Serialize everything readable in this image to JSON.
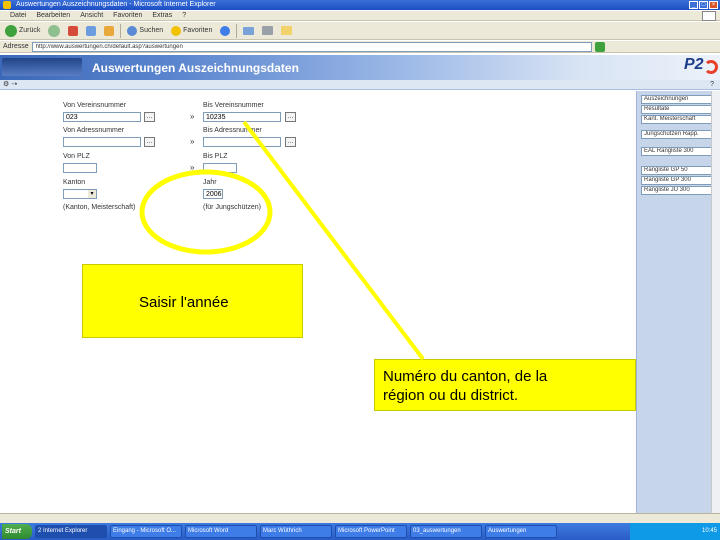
{
  "window": {
    "title": "Auswertungen Auszeichnungsdaten - Microsoft Internet Explorer"
  },
  "menu": [
    "Datei",
    "Bearbeiten",
    "Ansicht",
    "Favoriten",
    "Extras",
    "?"
  ],
  "toolbar": {
    "back": "Zurück",
    "search": "Suchen",
    "favorites": "Favoriten"
  },
  "address": {
    "label": "Adresse",
    "url": "http://www.auswertungen.ch/default.asp?auswertungen"
  },
  "banner": {
    "title": "Auswertungen Auszeichnungsdaten",
    "logo": "P2"
  },
  "subbar": {
    "help": "?"
  },
  "form": {
    "von_vereinsnummer_label": "Von Vereinsnummer",
    "von_vereinsnummer_value": "023",
    "bis_vereinsnummer_label": "Bis Vereinsnummer",
    "bis_vereinsnummer_value": "10235",
    "von_adressnummer_label": "Von Adressnummer",
    "bis_adressnummer_label": "Bis Adressnummer",
    "von_plz_label": "Von PLZ",
    "bis_plz_label": "Bis PLZ",
    "kanton_label": "Kanton",
    "jahr_label": "Jahr",
    "jahr_value": "2006",
    "arrow": "»",
    "lookup": "…",
    "footer_left": "(Kanton, Meisterschaft)",
    "footer_right": "(für Jungschützen)"
  },
  "right_panel": {
    "group1": [
      "Auszeichnungen",
      "Resultate",
      "Kant. Meisterschaft"
    ],
    "group2": [
      "Jungschützen Rapp."
    ],
    "group3": [
      "EAL Rangliste 300"
    ],
    "group4": [
      "Rangliste GP 50",
      "Rangliste GP 300",
      "Rangliste JU 300"
    ]
  },
  "taskbar": {
    "start": "Start",
    "tasks": [
      "2 Internet Explorer",
      "Eingang - Microsoft O...",
      "Microsoft Word",
      "Marc Wüthrich",
      "Microsoft PowerPoint",
      "03_auswertungen",
      "Auswertungen"
    ],
    "clock": "10:45"
  },
  "annotations": {
    "callout_year": "Saisir l'année",
    "callout_canton_line1": "Numéro du canton, de la",
    "callout_canton_line2": "région ou du district."
  },
  "colors": {
    "callout": "#ffff00",
    "banner_start": "#3b68b8",
    "panel": "#c7d5eb"
  }
}
